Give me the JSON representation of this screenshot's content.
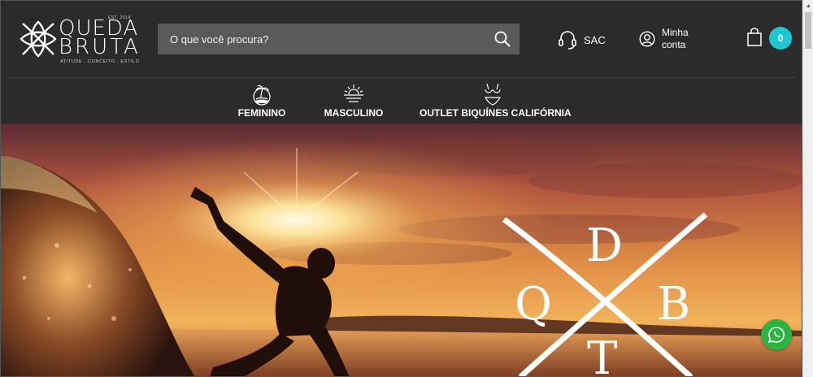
{
  "brand": {
    "line1": "QUEDA",
    "line2": "BRUTA",
    "est": "EST. 2014",
    "tagline": "ATITUDE · CONCEITO · ESTILO"
  },
  "search": {
    "placeholder": "O que você procura?",
    "value": ""
  },
  "header": {
    "sac_label": "SAC",
    "account_line1": "Minha",
    "account_line2": "conta",
    "cart_count": "0"
  },
  "nav": {
    "items": [
      {
        "label": "FEMININO",
        "icon": "palm-island-icon"
      },
      {
        "label": "MASCULINO",
        "icon": "sunset-beach-icon"
      },
      {
        "label": "OUTLET BIQUÍNES CALIFÓRNIA",
        "icon": "bikini-icon"
      }
    ]
  },
  "hero": {
    "emblem_letters": {
      "top": "D",
      "left": "Q",
      "right": "B",
      "bottom": "T"
    }
  },
  "colors": {
    "header_bg": "#2b2b2b",
    "search_bg": "#5a5a5a",
    "accent": "#1fc6d4",
    "whatsapp": "#2bb441"
  }
}
